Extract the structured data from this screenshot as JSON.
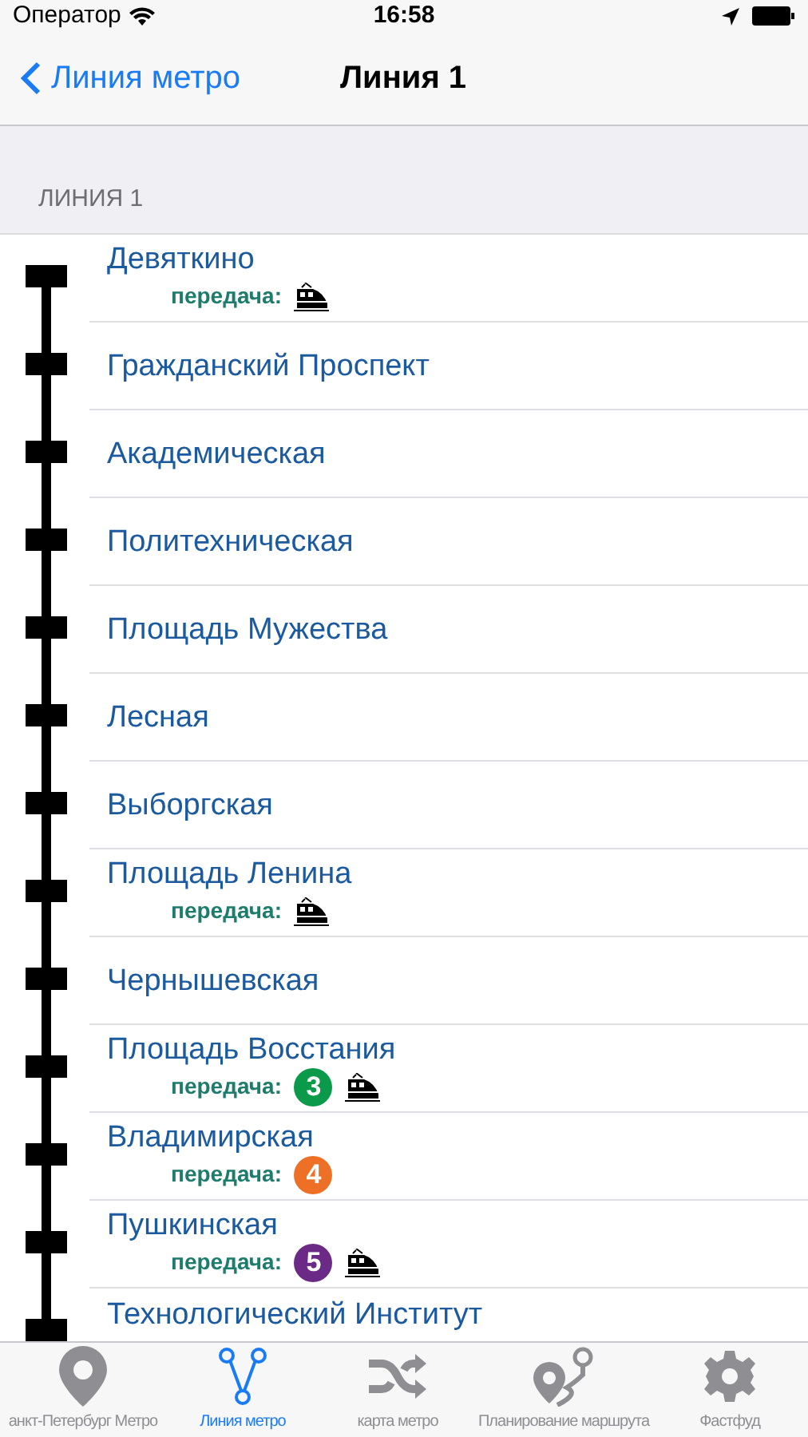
{
  "status_bar": {
    "carrier": "Оператор",
    "time": "16:58"
  },
  "nav": {
    "back": "Линия метро",
    "title": "Линия 1"
  },
  "section_header": "ЛИНИЯ 1",
  "stations": [
    {
      "name": "Девяткино",
      "transfer": {
        "label": "передача:",
        "train": true
      }
    },
    {
      "name": "Гражданский Проспект"
    },
    {
      "name": "Академическая"
    },
    {
      "name": "Политехническая"
    },
    {
      "name": "Площадь Мужества"
    },
    {
      "name": "Лесная"
    },
    {
      "name": "Выборгская"
    },
    {
      "name": "Площадь Ленина",
      "transfer": {
        "label": "передача:",
        "train": true
      }
    },
    {
      "name": "Чернышевская"
    },
    {
      "name": "Площадь Восстания",
      "transfer": {
        "label": "передача:",
        "lines": [
          {
            "number": "3",
            "color": "#0a9a4a"
          }
        ],
        "train": true
      }
    },
    {
      "name": "Владимирская",
      "transfer": {
        "label": "передача:",
        "lines": [
          {
            "number": "4",
            "color": "#ee7027"
          }
        ],
        "train": false
      }
    },
    {
      "name": "Пушкинская",
      "transfer": {
        "label": "передача:",
        "lines": [
          {
            "number": "5",
            "color": "#6b2a86"
          }
        ],
        "train": true
      }
    },
    {
      "name": "Технологический Институт"
    }
  ],
  "tabs": [
    {
      "label": "анкт-Петербург Метро",
      "kind": "pin",
      "selected": false
    },
    {
      "label": "Линия метро",
      "kind": "branch",
      "selected": true
    },
    {
      "label": "карта метро",
      "kind": "shuffle",
      "selected": false
    },
    {
      "label": "Планирование маршрута",
      "kind": "route",
      "selected": false
    },
    {
      "label": "Фастфуд",
      "kind": "gear",
      "selected": false
    }
  ]
}
